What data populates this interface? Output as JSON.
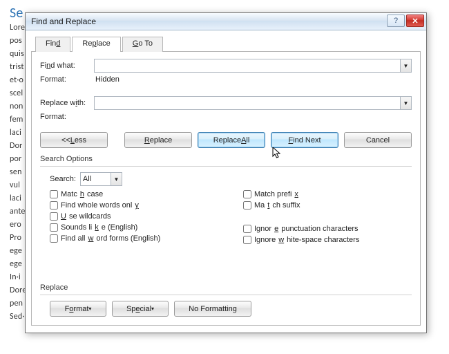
{
  "doc": {
    "heading": "Se",
    "lines": [
      "Lore",
      "pos",
      "quis",
      "trist                                                                                                                                                                                    auris·",
      "et·o",
      "scel",
      "non                                                                                                                                                                                     la.·",
      "fem                                                                                                                                                                                    ,·in·",
      "laci",
      "",
      "Dor                                                                                                                                                                                      nc·",
      "por",
      "sen",
      "vul                                                                                                                                                                                        elit·",
      "laci                                                                                                                                                                                      vel·",
      "ante",
      "ero",
      "Pro",
      "ege",
      "ege",
      "",
      "In·i",
      "Dore",
      "pen",
      "Sed·ac·ligula.·Aliquam·at·eros.·Etiam·at·ligula·et·tellus·ullamcorper·ultrices.·In·fermentum,·lorem·non·"
    ]
  },
  "dialog": {
    "title": "Find and Replace",
    "tabs": {
      "find": "Find",
      "replace": "Replace",
      "goto": "Go To"
    },
    "find_what_label": "Find what:",
    "find_what_value": "",
    "find_format_label": "Format:",
    "find_format_value": "Hidden",
    "replace_with_label": "Replace with:",
    "replace_with_value": "",
    "replace_format_label": "Format:",
    "replace_format_value": "",
    "buttons": {
      "less": "<< Less",
      "replace": "Replace",
      "replace_all": "Replace All",
      "find_next": "Find Next",
      "cancel": "Cancel"
    },
    "search_options_label": "Search Options",
    "search_label": "Search:",
    "search_value": "All",
    "checks": {
      "match_case": "Match case",
      "whole_words": "Find whole words only",
      "use_wildcards": "Use wildcards",
      "sounds_like": "Sounds like (English)",
      "word_forms": "Find all word forms (English)",
      "match_prefix": "Match prefix",
      "match_suffix": "Match suffix",
      "ignore_punct": "Ignore punctuation characters",
      "ignore_ws": "Ignore white-space characters"
    },
    "replace_group_label": "Replace",
    "bottom_buttons": {
      "format": "Format",
      "special": "Special",
      "no_formatting": "No Formatting"
    }
  }
}
